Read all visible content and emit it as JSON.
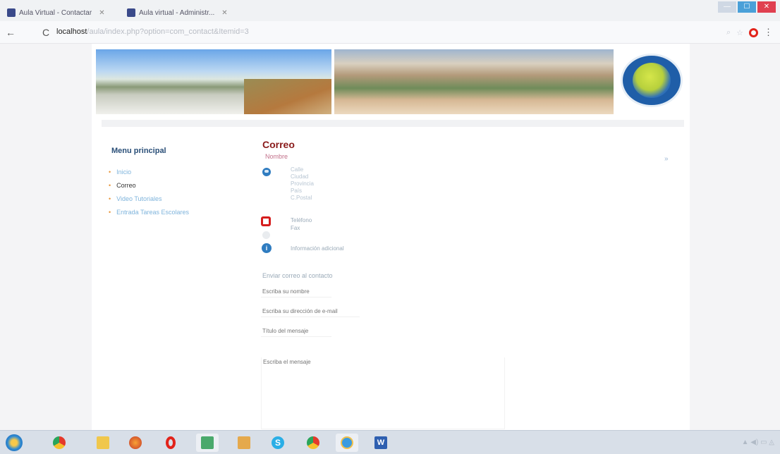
{
  "browser": {
    "tabs": [
      {
        "label": "Aula Virtual - Contactar",
        "active": true
      },
      {
        "label": "Aula virtual - Administr...",
        "active": false
      }
    ],
    "url": {
      "host": "localhost",
      "path": "/aula/index.php?option=com_contact&Itemid=3"
    },
    "window_controls": {
      "minimize": "—",
      "maximize": "☐",
      "close": "✕"
    }
  },
  "sidebar": {
    "title": "Menu principal",
    "items": [
      {
        "label": "Inicio",
        "active": false
      },
      {
        "label": "Correo",
        "active": true
      },
      {
        "label": "Video Tutoriales",
        "active": false
      },
      {
        "label": "Entrada Tareas Escolares",
        "active": false
      }
    ]
  },
  "contact": {
    "title": "Correo",
    "name_label": "Nombre",
    "address_fields": [
      "Calle",
      "Ciudad",
      "Provincia",
      "País",
      "C.Postal"
    ],
    "phone_label": "Teléfono",
    "fax_label": "Fax",
    "info_label": "Información adicional",
    "collapse_control": "»"
  },
  "form": {
    "heading": "Enviar correo al contacto",
    "name_placeholder": "Escriba su nombre",
    "email_placeholder": "Escriba su dirección de e-mail",
    "subject_placeholder": "Título del mensaje",
    "message_placeholder": "Escriba el mensaje"
  },
  "taskbar": {
    "apps": [
      "chrome",
      "folder",
      "firefox",
      "opera",
      "recycle",
      "paint",
      "skype",
      "chrome",
      "internet-explorer",
      "word"
    ],
    "word_label": "W",
    "skype_label": "S"
  },
  "colors": {
    "title": "#8a1b1b",
    "sidebar_title": "#2a4f78",
    "link": "#7fb4dc",
    "bullet": "#e8963a",
    "phone_icon": "#d51d1d"
  }
}
